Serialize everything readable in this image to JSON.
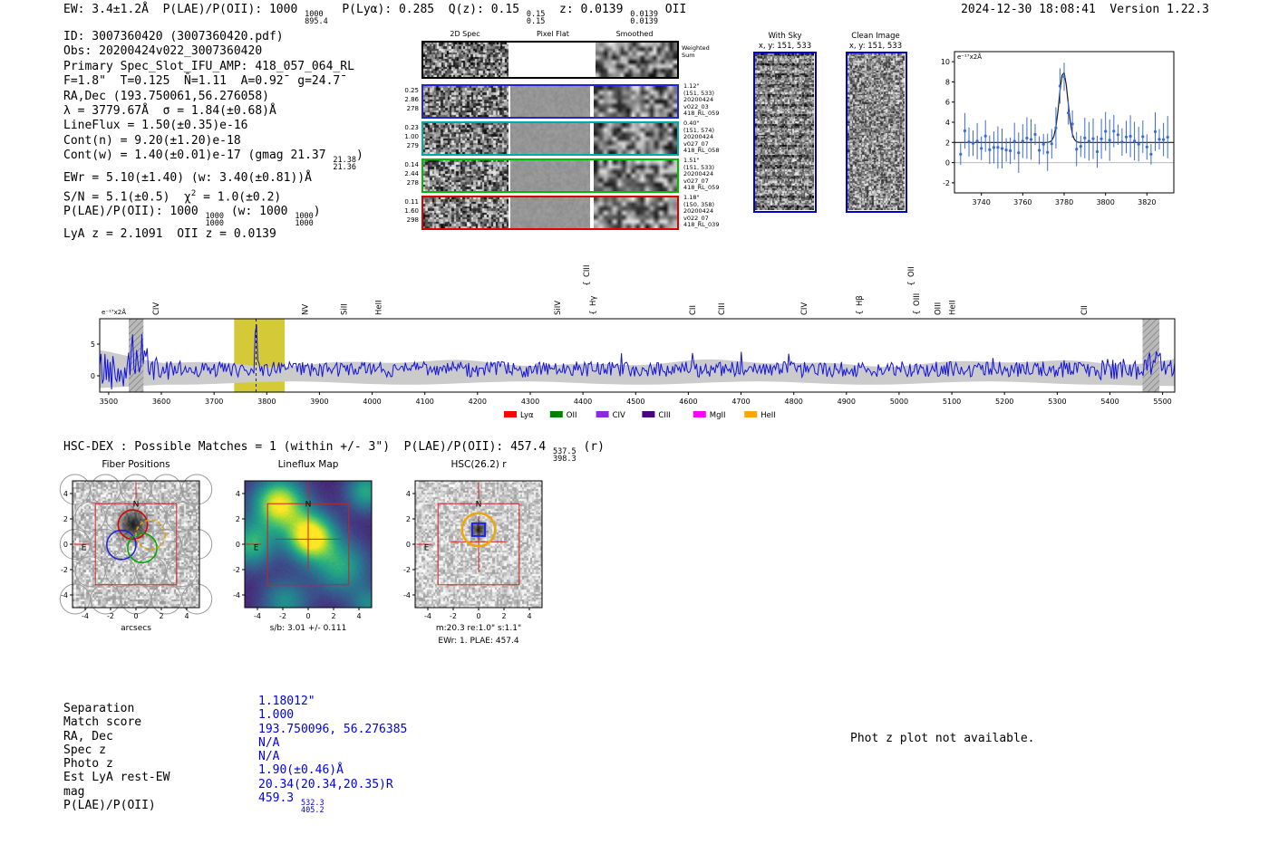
{
  "header": {
    "left_tokens": [
      "EW: 3.4±1.2Å  P(LAE)/P(OII): 1000 ",
      {
        "f": [
          "1000",
          "895.4"
        ]
      },
      "  P(Lyα): 0.285  Q(z): 0.15 ",
      {
        "f": [
          "0.15",
          "0.15"
        ]
      },
      "  z: 0.0139 ",
      {
        "f": [
          "0.0139",
          "0.0139"
        ]
      },
      " OII"
    ],
    "right": "2024-12-30 18:08:41  Version 1.22.3"
  },
  "info_lines": [
    [
      "ID: 3007360420 (3007360420.pdf)"
    ],
    [
      "Obs: 20200424v022_3007360420"
    ],
    [
      "Primary Spec_Slot_IFU_AMP: 418_057_064_RL"
    ],
    [
      "F=1.8\"  T=0.125  N̄=1.11  A=0.92̄  g=24.7̄"
    ],
    [
      "RA,Dec (193.750061,56.276058)"
    ],
    [
      "λ = 3779.67Å  σ = 1.84(±0.68)Å"
    ],
    [
      "LineFlux = 1.50(±0.35)e-16"
    ],
    [
      "Cont(n) = 9.20(±1.20)e-18"
    ],
    [
      "Cont(w) = 1.40(±0.01)e-17 (gmag 21.37 ",
      {
        "f": [
          "21.38",
          "21.36"
        ]
      },
      ")"
    ],
    [
      "EWr = 5.10(±1.40) (w: 3.40(±0.81))Å"
    ],
    [
      "S/N = 5.1(±0.5)  χ",
      {
        "sup": "2"
      },
      " = 1.0(±0.2)"
    ],
    [
      "P(LAE)/P(OII): 1000 ",
      {
        "f": [
          "1000",
          "1000"
        ]
      },
      " (w: 1000 ",
      {
        "f": [
          "1000",
          "1000"
        ]
      },
      ")"
    ],
    [
      "LyA z = 2.1091  OII z = 0.0139"
    ]
  ],
  "spec2d": {
    "columns": [
      "2D Spec",
      "Pixel Flat",
      "Smoothed"
    ],
    "weighted_sum_label": [
      "Weighted",
      "Sum"
    ],
    "rows": [
      {
        "stats": [
          "0.25",
          "2.86",
          "278"
        ],
        "color": "#2222dd",
        "ann": [
          "1.12\"",
          "(151, 533)",
          "20200424",
          "v022_03",
          "418_RL_059"
        ]
      },
      {
        "stats": [
          "0.23",
          "1.00",
          "279"
        ],
        "color": "#00aaaa",
        "ann": [
          "0.40\"",
          "(151, 574)",
          "20200424",
          "v027_07",
          "418_RL_058"
        ]
      },
      {
        "stats": [
          "0.14",
          "2.44",
          "278"
        ],
        "color": "#00bb00",
        "ann": [
          "1.51\"",
          "(151, 533)",
          "20200424",
          "v027_07",
          "418_RL_059"
        ]
      },
      {
        "stats": [
          "0.11",
          "1.60",
          "298"
        ],
        "color": "#dd0000",
        "ann": [
          "1.18\"",
          "(150, 358)",
          "20200424",
          "v022_07",
          "418_RL_039"
        ]
      }
    ]
  },
  "sky_panels": [
    {
      "title": "With Sky",
      "coords": "x, y: 151, 533",
      "frame_color": "#0000cc"
    },
    {
      "title": "Clean Image",
      "coords": "x, y: 151, 533",
      "frame_color": "#0000cc"
    }
  ],
  "chart_data": [
    {
      "id": "zoom",
      "type": "scatter",
      "ylabel": "e⁻¹⁷x2Å",
      "xlim": [
        3727,
        3833
      ],
      "ylim": [
        -3,
        11
      ],
      "x_ticks": [
        3740,
        3760,
        3780,
        3800,
        3820
      ],
      "y_ticks": [
        -2,
        0,
        2,
        4,
        6,
        8,
        10
      ],
      "peak": {
        "center": 3779.67,
        "sigma": 1.84,
        "sigma_fit": 2.1,
        "amplitude": 7.0,
        "continuum": 2.0
      },
      "point_color": "#3a6bdc",
      "fit_color": "#1a1a1a"
    },
    {
      "id": "main",
      "type": "line",
      "ylabel": "e⁻¹⁷x2Å",
      "xlim": [
        3483,
        5523
      ],
      "ylim": [
        -2.57,
        9
      ],
      "x_ticks": [
        3500,
        3600,
        3700,
        3800,
        3900,
        4000,
        4100,
        4200,
        4300,
        4400,
        4500,
        4600,
        4700,
        4800,
        4900,
        5000,
        5100,
        5200,
        5300,
        5400,
        5500
      ],
      "y_ticks": [
        0,
        5
      ],
      "continuum": 1.0,
      "noise_amp": 1.25,
      "peak": {
        "center": 3779.67,
        "amplitude": 6.8,
        "sigma": 1.9
      },
      "highlight_band": [
        3738,
        3834
      ],
      "highlight_color": "#cfc421",
      "masked_bands": [
        [
          3538,
          3566
        ],
        [
          5462,
          5494
        ]
      ],
      "dashed_line": 3779.67,
      "line_color": "#1212dd",
      "line_labels": [
        {
          "wave": 3595,
          "label": "CIV",
          "color": "#e09c00",
          "tier": 0,
          "brace": false
        },
        {
          "wave": 3878,
          "label": "NV",
          "color": "#dd0000",
          "tier": 0,
          "brace": false
        },
        {
          "wave": 3952,
          "label": "SiII",
          "color": "#dd0000",
          "tier": 0,
          "brace": false
        },
        {
          "wave": 4017,
          "label": "HeII",
          "color": "#9400d3",
          "tier": 0,
          "brace": false
        },
        {
          "wave": 4357,
          "label": "SiIV",
          "color": "#dd0000",
          "tier": 0,
          "brace": false
        },
        {
          "wave": 4412,
          "label": "CIII",
          "color": "#e09c00",
          "tier": 1,
          "brace": true
        },
        {
          "wave": 4424,
          "label": "Hγ",
          "color": "#009000",
          "tier": 0,
          "brace": true
        },
        {
          "wave": 4613,
          "label": "CII",
          "color": "#9400d3",
          "tier": 0,
          "brace": false
        },
        {
          "wave": 4668,
          "label": "CIII",
          "color": "#9400d3",
          "tier": 0,
          "brace": false
        },
        {
          "wave": 4825,
          "label": "CIV",
          "color": "#dd0000",
          "tier": 0,
          "brace": false
        },
        {
          "wave": 4930,
          "label": "Hβ",
          "color": "#009000",
          "tier": 0,
          "brace": true
        },
        {
          "wave": 5028,
          "label": "OII",
          "color": "#ff00ff",
          "tier": 1,
          "brace": true
        },
        {
          "wave": 5038,
          "label": "OIII",
          "color": "#009000",
          "tier": 0,
          "brace": true
        },
        {
          "wave": 5078,
          "label": "OIII",
          "color": "#009000",
          "tier": 0,
          "brace": false
        },
        {
          "wave": 5106,
          "label": "HeII",
          "color": "#dd0000",
          "tier": 0,
          "brace": false
        },
        {
          "wave": 5356,
          "label": "CII",
          "color": "#e09c00",
          "tier": 0,
          "brace": false
        }
      ],
      "legend": [
        {
          "label": "Lyα",
          "color": "#ff0000"
        },
        {
          "label": "OII",
          "color": "#008000"
        },
        {
          "label": "CIV",
          "color": "#8a2be2"
        },
        {
          "label": "CIII",
          "color": "#4b0082"
        },
        {
          "label": "MgII",
          "color": "#ff00ff"
        },
        {
          "label": "HeII",
          "color": "#ffa500"
        }
      ]
    }
  ],
  "hsc_header": [
    "HSC-DEX : Possible Matches = 1 (within +/- 3\")  P(LAE)/P(OII): 457.4 ",
    {
      "f": [
        "537.5",
        "398.3"
      ]
    },
    " (r)"
  ],
  "cutouts": [
    {
      "title": "Fiber Positions",
      "xlabel": "arcsecs",
      "axis_ticks": [
        -4,
        -2,
        0,
        2,
        4
      ],
      "compass_n": "N",
      "compass_e": "E"
    },
    {
      "title": "Lineflux Map",
      "caption": "s/b: 3.01 +/- 0.111",
      "axis_ticks": [
        -4,
        -2,
        0,
        2,
        4
      ],
      "compass_n": "N",
      "compass_e": "E"
    },
    {
      "title": "HSC(26.2) r",
      "caption": "m:20.3 re:1.0\" s:1.1\"",
      "caption2": "EWr: 1. PLAE: 457.4",
      "axis_ticks": [
        -4,
        -2,
        0,
        2,
        4
      ],
      "compass_n": "N",
      "compass_e": "E"
    }
  ],
  "match_table": {
    "value_color": "#0000e6",
    "labels": [
      "Separation",
      "Match score",
      "RA, Dec",
      "Spec z",
      "Photo z",
      "Est LyA rest-EW",
      "mag",
      "P(LAE)/P(OII)"
    ],
    "values": [
      [
        "1.18012\""
      ],
      [
        "1.000"
      ],
      [
        "193.750096, 56.276385"
      ],
      [
        "N/A"
      ],
      [
        "N/A"
      ],
      [
        "1.90(±0.46)Å"
      ],
      [
        "20.34(20.34,20.35)R"
      ],
      [
        "459.3 ",
        {
          "f": [
            "532.3",
            "405.2"
          ]
        }
      ]
    ]
  },
  "footnote": "Phot z plot not available."
}
